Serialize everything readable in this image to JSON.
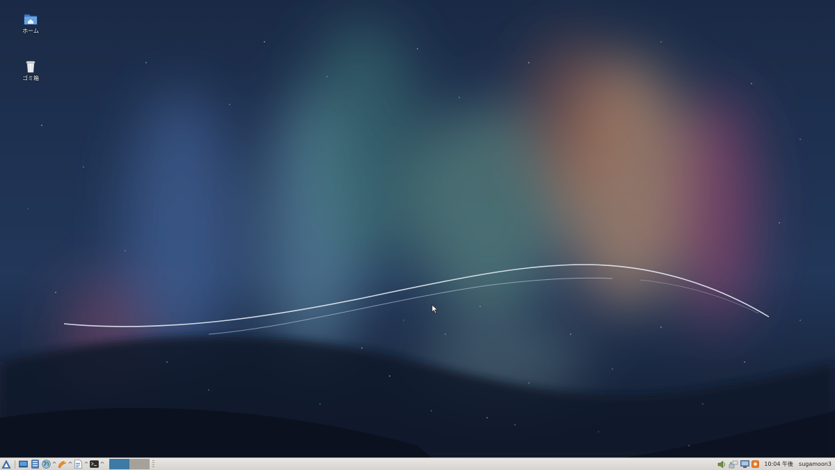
{
  "desktop": {
    "icons": [
      {
        "id": "home",
        "label": "ホーム",
        "icon": "home-folder-icon"
      },
      {
        "id": "trash",
        "label": "ゴミ箱",
        "icon": "trash-icon"
      }
    ]
  },
  "taskbar": {
    "launchers": [
      {
        "name": "menu-launcher",
        "icon": "app-menu-icon"
      },
      {
        "name": "show-desktop",
        "icon": "desktop-icon"
      },
      {
        "name": "file-manager",
        "icon": "file-manager-icon"
      },
      {
        "name": "web-browser",
        "icon": "globe-icon"
      },
      {
        "name": "mail-client",
        "icon": "mail-icon"
      },
      {
        "name": "text-editor",
        "icon": "document-icon"
      },
      {
        "name": "terminal",
        "icon": "terminal-icon"
      }
    ],
    "caret": "^",
    "pager": {
      "active_desktop": 1,
      "desktop_count": 2
    },
    "tray": [
      "volume-icon",
      "network-icon",
      "display-icon",
      "update-notifier-icon"
    ],
    "clock": "10:04 午後",
    "user": "sugamoon3"
  },
  "colors": {
    "taskbar_bg": "#e0dedb",
    "pager_active": "#3d7aa6",
    "pager_inactive": "#a7a19b"
  }
}
